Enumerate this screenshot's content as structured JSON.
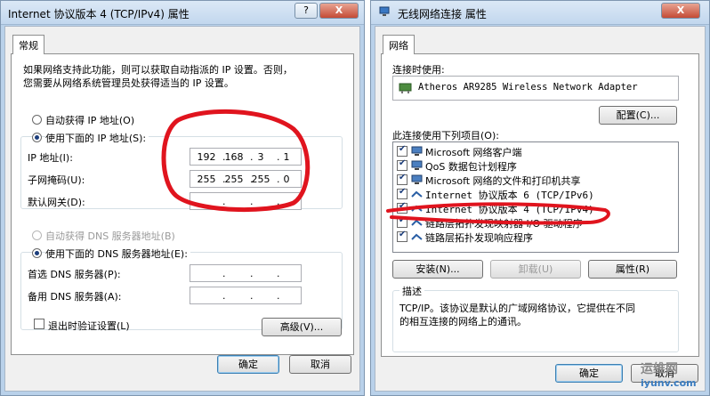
{
  "ipv4_dialog": {
    "title": "Internet 协议版本 4 (TCP/IPv4) 属性",
    "help_btn": "?",
    "close_btn": "X",
    "tab": "常规",
    "desc_line1": "如果网络支持此功能，则可以获取自动指派的 IP 设置。否则，",
    "desc_line2": "您需要从网络系统管理员处获得适当的 IP 设置。",
    "auto_ip": "自动获得 IP 地址(O)",
    "use_ip": "使用下面的 IP 地址(S):",
    "ip_label": "IP 地址(I):",
    "ip_value": [
      "192",
      "168",
      "3",
      "1"
    ],
    "mask_label": "子网掩码(U):",
    "mask_value": [
      "255",
      "255",
      "255",
      "0"
    ],
    "gw_label": "默认网关(D):",
    "auto_dns": "自动获得 DNS 服务器地址(B)",
    "use_dns": "使用下面的 DNS 服务器地址(E):",
    "dns1_label": "首选 DNS 服务器(P):",
    "dns2_label": "备用 DNS 服务器(A):",
    "validate": "退出时验证设置(L)",
    "advanced": "高级(V)...",
    "ok": "确定",
    "cancel": "取消",
    "ip_dot": "."
  },
  "conn_dialog": {
    "title": "无线网络连接 属性",
    "close_btn": "X",
    "tab": "网络",
    "connect_using": "连接时使用:",
    "adapter": "Atheros AR9285 Wireless Network Adapter",
    "configure": "配置(C)...",
    "items_label": "此连接使用下列项目(O):",
    "items": [
      {
        "label": "Microsoft 网络客户端",
        "icon": "network-client-icon"
      },
      {
        "label": "QoS 数据包计划程序",
        "icon": "qos-icon"
      },
      {
        "label": "Microsoft 网络的文件和打印机共享",
        "icon": "file-share-icon"
      },
      {
        "label": "Internet 协议版本 6 (TCP/IPv6)",
        "icon": "protocol-icon"
      },
      {
        "label": "Internet 协议版本 4 (TCP/IPv4)",
        "icon": "protocol-icon"
      },
      {
        "label": "链路层拓扑发现映射器 I/O 驱动程序",
        "icon": "protocol-icon"
      },
      {
        "label": "链路层拓扑发现响应程序",
        "icon": "protocol-icon"
      }
    ],
    "install": "安装(N)...",
    "uninstall": "卸载(U)",
    "properties": "属性(R)",
    "desc_title": "描述",
    "desc_line1": "TCP/IP。该协议是默认的广域网络协议，它提供在不同",
    "desc_line2": "的相互连接的网络上的通讯。",
    "ok": "确定",
    "cancel": "取消"
  },
  "watermark": {
    "line1": "运维网",
    "line2": "iyunv.com"
  },
  "colors": {
    "annotation_red": "#e0141e",
    "window_frame": "#b9d1ea"
  }
}
